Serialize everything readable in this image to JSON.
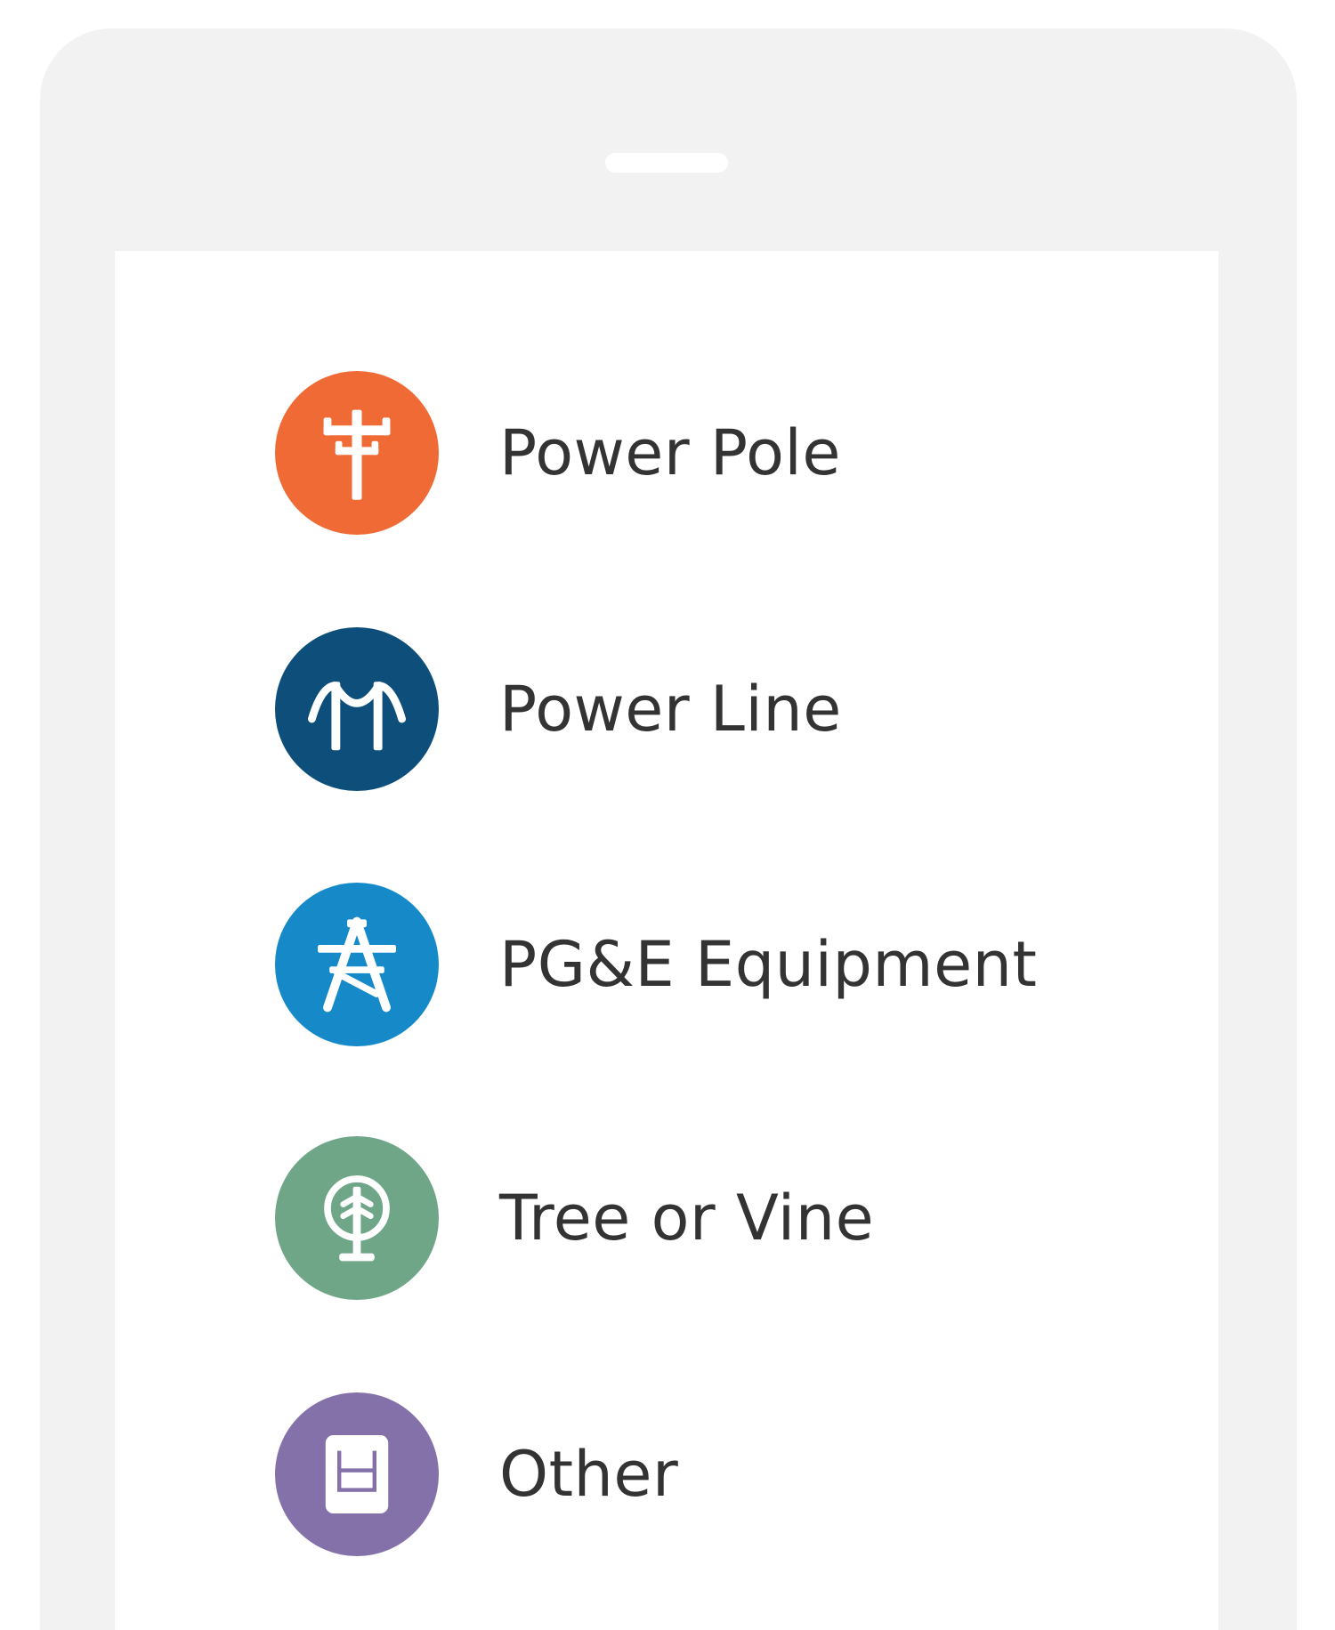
{
  "menu": {
    "items": [
      {
        "label": "Power Pole",
        "icon": "power-pole-icon",
        "color": "#f06a35"
      },
      {
        "label": "Power Line",
        "icon": "power-line-icon",
        "color": "#0d4f7a"
      },
      {
        "label": "PG&E Equipment",
        "icon": "transmission-tower-icon",
        "color": "#1689c8"
      },
      {
        "label": "Tree or Vine",
        "icon": "tree-icon",
        "color": "#6fa688"
      },
      {
        "label": "Other",
        "icon": "document-icon",
        "color": "#8471a9"
      }
    ]
  }
}
